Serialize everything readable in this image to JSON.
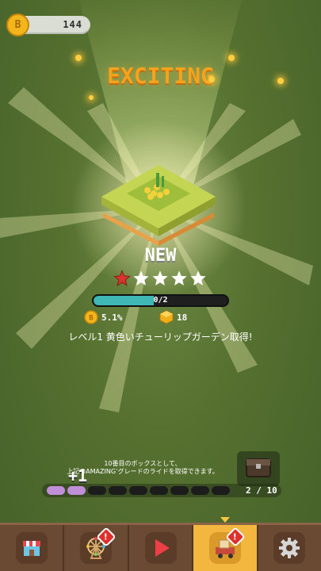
{
  "currency": {
    "coins": "144",
    "coin_symbol": "B"
  },
  "reveal": {
    "headline": "EXCITING",
    "new_label": "NEW",
    "stars_filled": 1,
    "stars_total": 5,
    "progress_text": "0/2",
    "progress_fraction": 0.45,
    "stat_rate": "5.1%",
    "stat_rate_symbol": "B",
    "stat_gems": "18",
    "reward_message": "レベル1 黄色いチューリップガーデン取得!"
  },
  "box_track": {
    "hint_line1": "10番目のボックスとして、",
    "hint_line2": "上記のAMAZING’グレードのライドを取得できます。",
    "plus_label": "+1",
    "filled_segments": 2,
    "total_segments": 9,
    "count_text": "2 / 10"
  },
  "nav": {
    "items": [
      {
        "name": "shop",
        "icon": "shop-icon",
        "badge": ""
      },
      {
        "name": "ferris-wheel",
        "icon": "ferris-wheel-icon",
        "badge": "!"
      },
      {
        "name": "play",
        "icon": "play-icon",
        "badge": ""
      },
      {
        "name": "boxes",
        "icon": "box-truck-icon",
        "badge": "!"
      },
      {
        "name": "settings",
        "icon": "gear-icon",
        "badge": ""
      }
    ],
    "active_index": 3
  },
  "colors": {
    "headline": "#f5a21d",
    "progress_fill": "#3fb7b4",
    "segment_on": "#c18ed8",
    "nav_active": "#f3b63f",
    "star_filled": "#d8342c",
    "star_empty": "#ffffff"
  }
}
